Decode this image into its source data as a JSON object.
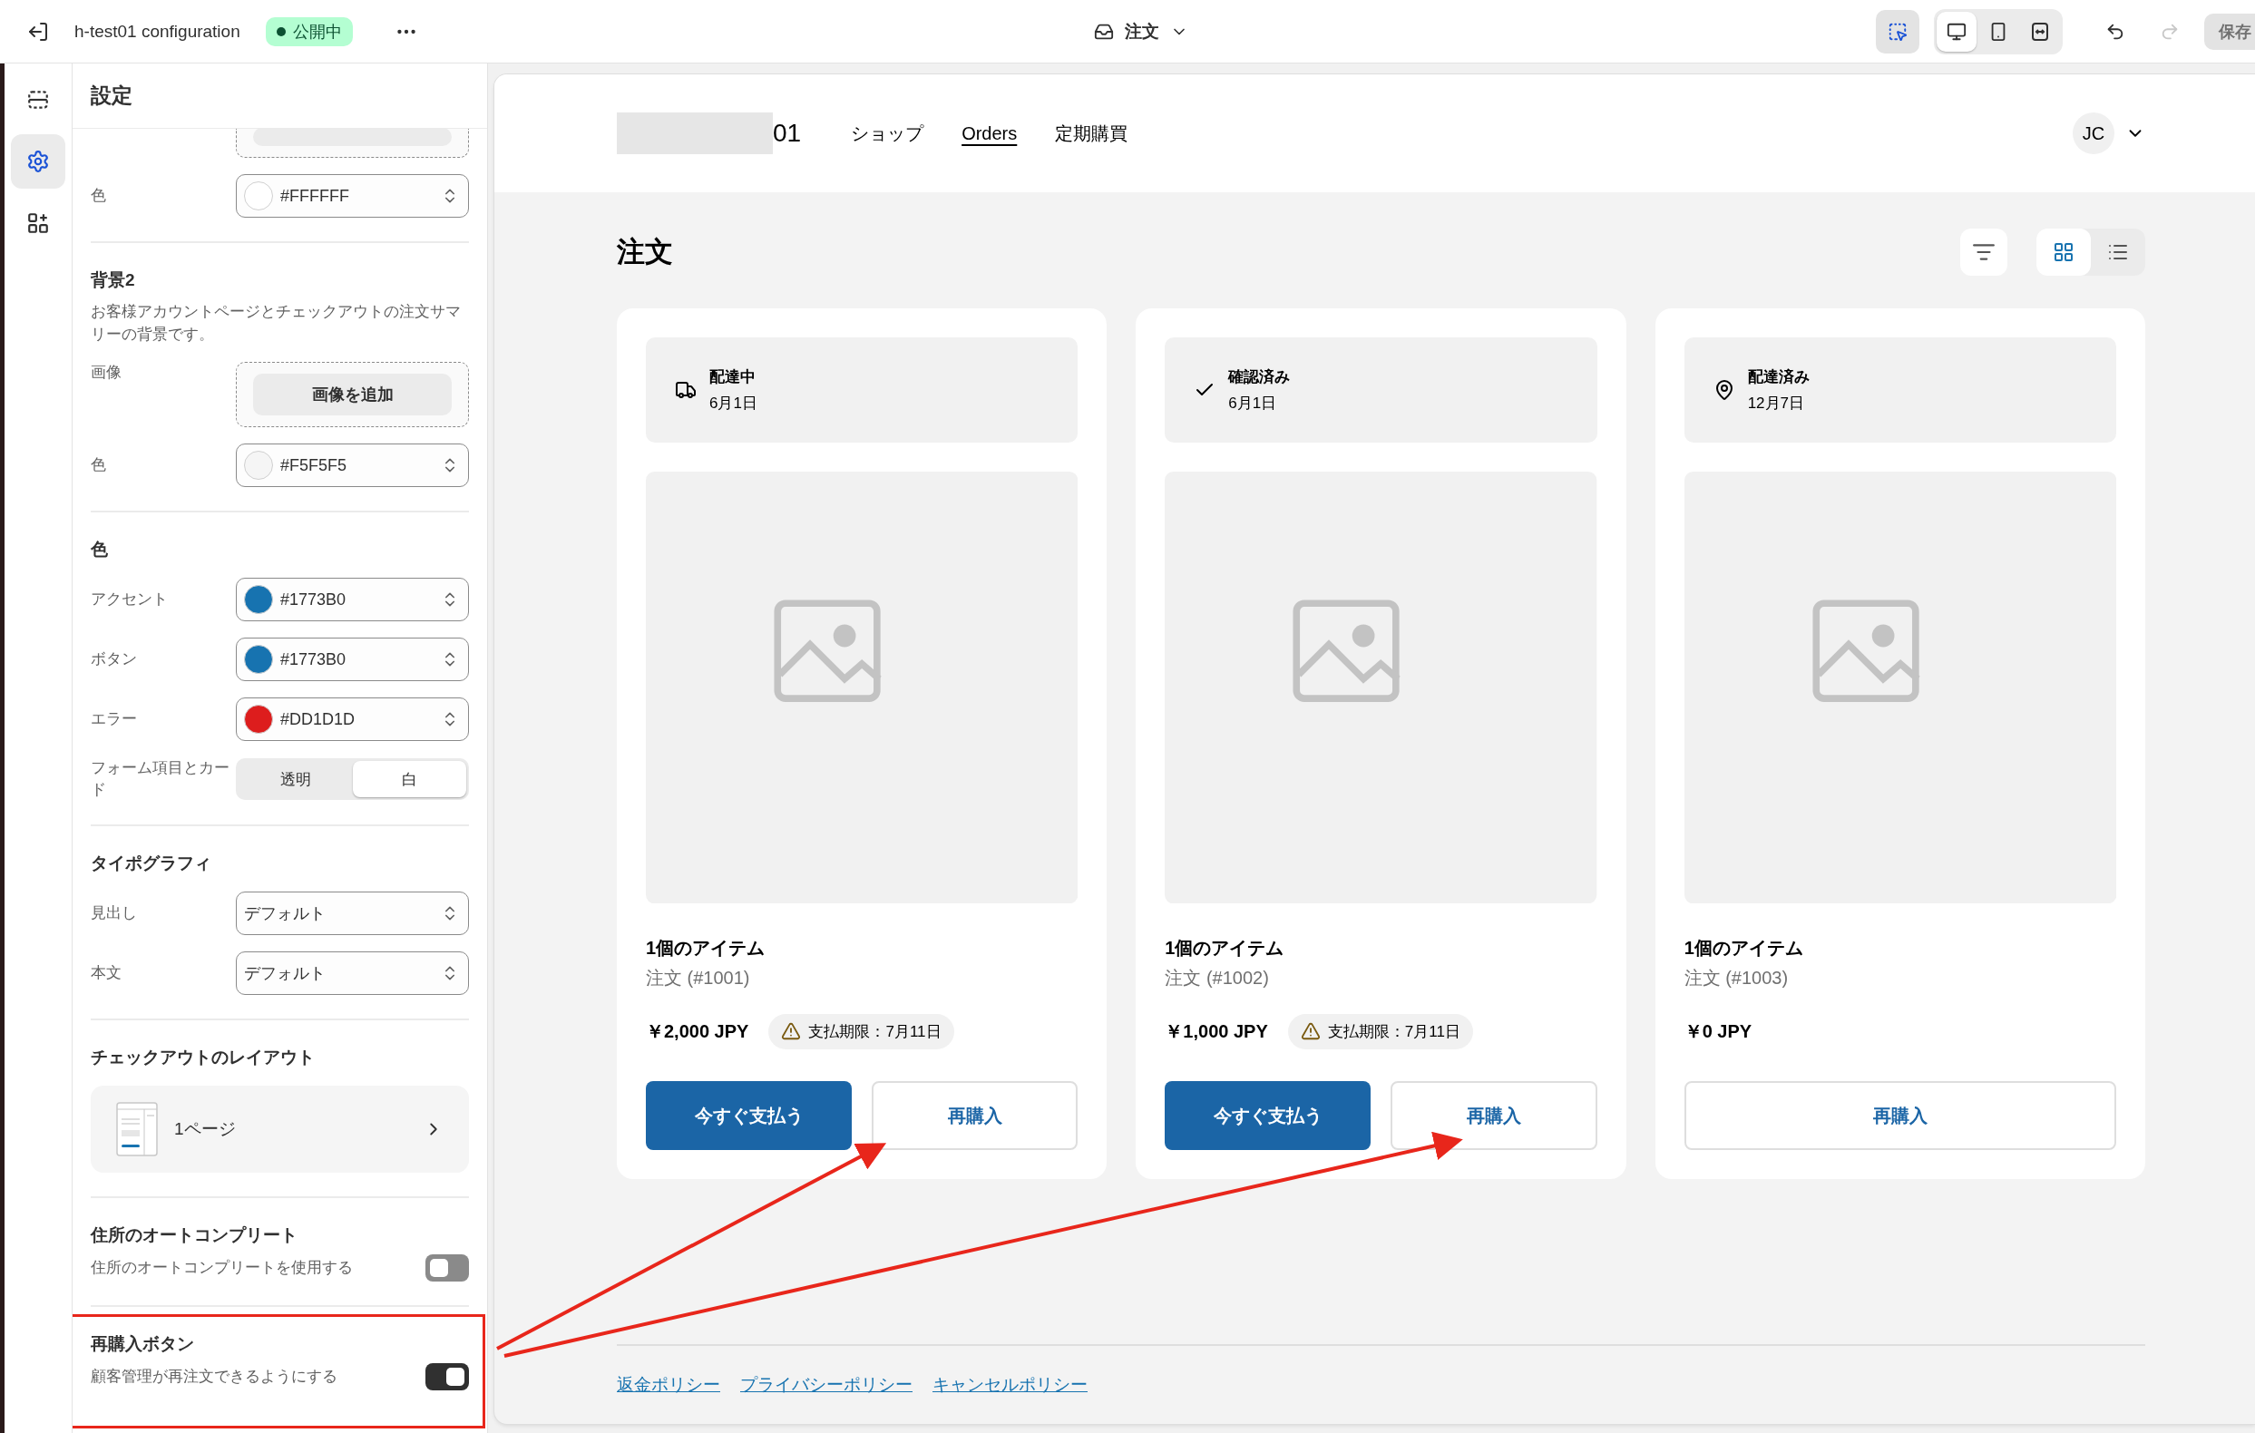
{
  "top_bar": {
    "title": "h-test01 configuration",
    "status": "公開中",
    "page": "注文",
    "tools": [
      {
        "kind": "inspector",
        "selected": true
      }
    ],
    "devices": [
      {
        "kind": "desktop",
        "selected": true
      },
      {
        "kind": "mobile",
        "selected": false
      },
      {
        "kind": "fullwidth",
        "selected": false
      }
    ],
    "undo": {
      "disabled": false
    },
    "redo": {
      "disabled": true
    },
    "save": {
      "label": "保存",
      "disabled": true
    }
  },
  "rail": [
    {
      "kind": "sections",
      "selected": false
    },
    {
      "kind": "settings",
      "selected": true
    },
    {
      "kind": "apps",
      "selected": false
    }
  ],
  "settings": {
    "title": "設定",
    "groups": [
      {
        "rows": [
          {
            "kind": "image_tail"
          },
          {
            "kind": "color",
            "label": "色",
            "value": "#FFFFFF",
            "color": "#ffffff"
          }
        ]
      },
      {
        "heading": "背景2",
        "description": "お客様アカウントページとチェックアウトの注文サマリーの背景です。",
        "rows": [
          {
            "label": "画像",
            "button": "画像を追加"
          },
          {
            "kind": "color",
            "label": "色",
            "value": "#F5F5F5",
            "color": "#f5f5f5"
          }
        ]
      },
      {
        "heading": "色",
        "rows": [
          {
            "kind": "color",
            "label": "アクセント",
            "value": "#1773B0",
            "color": "#1773b0"
          },
          {
            "kind": "color",
            "label": "ボタン",
            "value": "#1773B0",
            "color": "#1773b0"
          },
          {
            "kind": "color",
            "label": "エラー",
            "value": "#DD1D1D",
            "color": "#dd1d1d"
          },
          {
            "kind": "segmented",
            "label": "フォーム項目とカード",
            "options": [
              {
                "label": "透明",
                "selected": false
              },
              {
                "label": "白",
                "selected": true
              }
            ]
          }
        ]
      },
      {
        "heading": "タイポグラフィ",
        "rows": [
          {
            "kind": "select",
            "label": "見出し",
            "value": "デフォルト"
          },
          {
            "kind": "select",
            "label": "本文",
            "value": "デフォルト"
          }
        ]
      },
      {
        "heading": "チェックアウトのレイアウト",
        "rows": [
          {
            "kind": "layout",
            "label": "1ページ"
          }
        ]
      },
      {
        "heading": "住所のオートコンプリート",
        "rows": [
          {
            "kind": "toggle",
            "label": "住所のオートコンプリートを使用する",
            "on": false
          }
        ]
      },
      {
        "heading": "再購入ボタン",
        "highlighted": true,
        "rows": [
          {
            "kind": "toggle",
            "label": "顧客管理が再注文できるようにする",
            "on": true
          }
        ]
      }
    ]
  },
  "preview": {
    "header": {
      "logo_text": "01",
      "nav": [
        {
          "label": "ショップ",
          "selected": false
        },
        {
          "label": "Orders",
          "selected": true
        },
        {
          "label": "定期購買",
          "selected": false
        }
      ],
      "avatar": "JC"
    },
    "title": "注文",
    "views": [
      {
        "kind": "grid",
        "selected": true
      },
      {
        "kind": "list",
        "selected": false
      }
    ],
    "orders": [
      {
        "status": {
          "kind": "shipping",
          "label": "配達中",
          "date": "6月1日"
        },
        "items": "1個のアイテム",
        "number": "注文 (#1001)",
        "total": "￥2,000 JPY",
        "due": "支払期限：7月11日",
        "pay_button": "今すぐ支払う",
        "reorder_button": "再購入"
      },
      {
        "status": {
          "kind": "confirmed",
          "label": "確認済み",
          "date": "6月1日"
        },
        "items": "1個のアイテム",
        "number": "注文 (#1002)",
        "total": "￥1,000 JPY",
        "due": "支払期限：7月11日",
        "pay_button": "今すぐ支払う",
        "reorder_button": "再購入"
      },
      {
        "status": {
          "kind": "delivered",
          "label": "配達済み",
          "date": "12月7日"
        },
        "items": "1個のアイテム",
        "number": "注文 (#1003)",
        "total": "￥0 JPY",
        "reorder_button": "再購入"
      }
    ],
    "footer_links": [
      "返金ポリシー",
      "プライバシーポリシー",
      "キャンセルポリシー"
    ]
  }
}
